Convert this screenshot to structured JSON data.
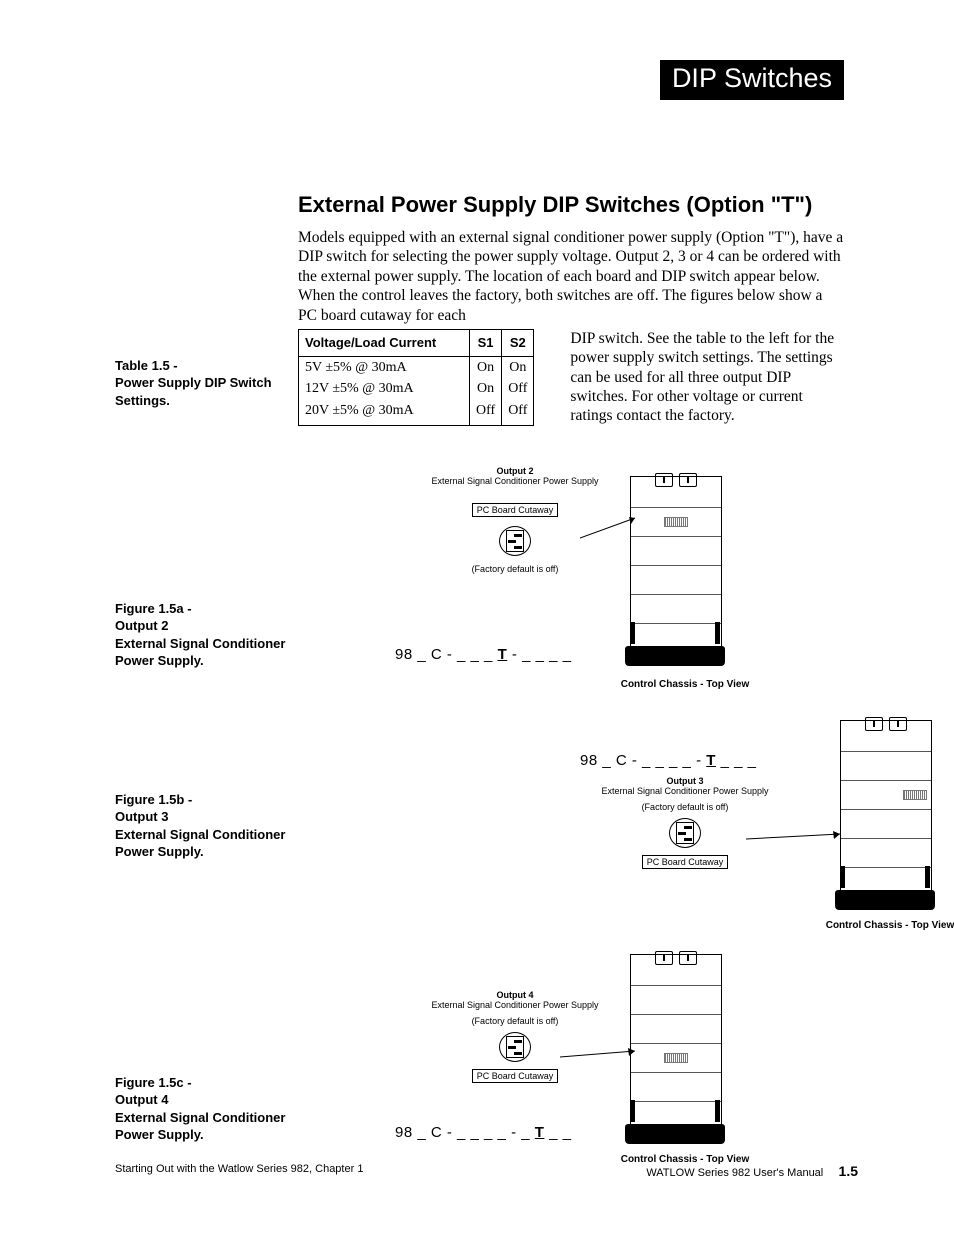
{
  "header_tab": "DIP Switches",
  "section_title": "External Power Supply DIP Switches  (Option \"T\")",
  "intro_para": "Models equipped with an external signal conditioner power supply (Option \"T\"),  have a DIP switch for selecting the power supply voltage. Output 2, 3 or 4 can be ordered with the external power supply. The location of each board and DIP switch appear below. When the control leaves the factory, both switches are off. The figures below show a PC board cutaway for each",
  "table_caption": "Table 1.5 -\nPower Supply DIP Switch Settings.",
  "table": {
    "headers": [
      "Voltage/Load Current",
      "S1",
      "S2"
    ],
    "rows": [
      {
        "v": "5V ±5%   @ 30mA",
        "s1": "On",
        "s2": "On"
      },
      {
        "v": "12V ±5%  @ 30mA",
        "s1": "On",
        "s2": "Off"
      },
      {
        "v": "20V ±5%  @ 30mA",
        "s1": "Off",
        "s2": "Off"
      }
    ]
  },
  "right_para": "DIP switch. See the table to the left for the power supply switch settings. The settings can be used for all three output DIP switches. For other voltage or current ratings contact the factory.",
  "figures": [
    {
      "caption": "Figure  1.5a -\nOutput 2\nExternal Signal Conditioner\nPower Supply.",
      "output_label_1": "Output 2",
      "output_label_2": "External Signal Conditioner Power Supply",
      "pc_cutaway": "PC Board Cutaway",
      "factory_default": "(Factory default is off)",
      "chassis_label": "Control Chassis - Top View",
      "model_no_parts": [
        "98 _ C - _ _ _ ",
        "T",
        " - _ _ _ _"
      ]
    },
    {
      "caption": "Figure 1.5b -\nOutput 3\nExternal Signal Conditioner\nPower Supply.",
      "output_label_1": "Output 3",
      "output_label_2": "External Signal Conditioner Power Supply",
      "pc_cutaway": "PC Board Cutaway",
      "factory_default": "(Factory default is off)",
      "chassis_label": "Control Chassis - Top View",
      "model_no_parts": [
        "98 _ C - _ _ _ _ - ",
        "T",
        " _ _ _"
      ]
    },
    {
      "caption": "Figure 1.5c -\nOutput 4\nExternal Signal Conditioner\nPower Supply.",
      "output_label_1": "Output 4",
      "output_label_2": "External Signal Conditioner Power Supply",
      "pc_cutaway": "PC Board Cutaway",
      "factory_default": "(Factory default is off)",
      "chassis_label": "Control Chassis - Top View",
      "model_no_parts": [
        "98 _ C - _ _ _ _ - _ ",
        "T",
        " _ _"
      ]
    }
  ],
  "footer_left": "Starting Out with the Watlow Series 982, Chapter 1",
  "footer_right": "WATLOW Series 982 User's Manual",
  "page_number": "1.5"
}
